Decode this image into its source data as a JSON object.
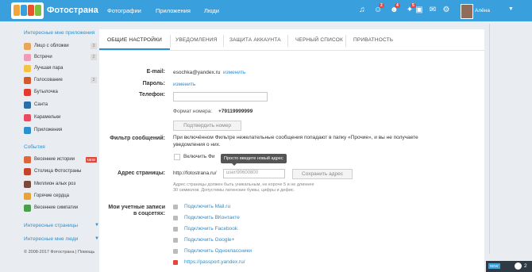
{
  "header": {
    "brand": "Фотострана",
    "nav": [
      "Фотографии",
      "Приложения",
      "Люди"
    ],
    "badges": [
      "2",
      "4",
      "5"
    ],
    "user": "Алёна"
  },
  "sidebar": {
    "section1": "Интересные мне приложения",
    "apps": [
      {
        "label": "Лицо с обложки",
        "count": "3",
        "color": "#e8a65a"
      },
      {
        "label": "Встречи",
        "count": "2",
        "color": "#f09bb8"
      },
      {
        "label": "Лучшая пара",
        "color": "#f6c243"
      },
      {
        "label": "Голосование",
        "count": "2",
        "color": "#d45a2b"
      },
      {
        "label": "Бутылочка",
        "color": "#e23a2e"
      },
      {
        "label": "Санта",
        "color": "#2a6fa8"
      },
      {
        "label": "Карамельки",
        "color": "#e84a5f"
      },
      {
        "label": "Приложения",
        "color": "#2c8fce"
      }
    ],
    "section2": "События",
    "events": [
      {
        "label": "Весенние истории",
        "badge": "NEW",
        "color": "#e0663a"
      },
      {
        "label": "Столица Фотостраны",
        "color": "#c4442a"
      },
      {
        "label": "Миллион алых роз",
        "color": "#7a4b3a"
      },
      {
        "label": "Горячие сердца",
        "color": "#e7a23a"
      },
      {
        "label": "Весенние симпатии",
        "color": "#4aa04a"
      }
    ],
    "section3": "Интересные страницы",
    "section4": "Интересные мне люди",
    "copyright": "© 2008-2017 Фотострана | Помощь"
  },
  "tabs": [
    "ОБЩИЕ НАСТРОЙКИ",
    "УВЕДОМЛЕНИЯ",
    "ЗАЩИТА АККАУНТА",
    "ЧЕРНЫЙ СПИСОК",
    "ПРИВАТНОСТЬ"
  ],
  "form": {
    "email_label": "E-mail:",
    "email_value": "esochka@yandex.ru",
    "email_change": "изменить",
    "password_label": "Пароль:",
    "password_change": "изменить",
    "phone_label": "Телефон:",
    "phone_format_label": "Формат номера:",
    "phone_format": "+79119999999",
    "confirm_button": "Подтвердить номер",
    "filter_label": "Фильтр сообщений:",
    "filter_text_1": "При включённом Фильтре нежелательные сообщения попадают в папку «Прочие», и вы не получаете",
    "filter_text_2": "уведомления о них.",
    "filter_checkbox": "Включить Фи",
    "tooltip": "Просто введите новый адрес",
    "address_label": "Адрес страницы:",
    "address_prefix": "http://fotostrana.ru/",
    "address_placeholder": "user/90600800",
    "save_address": "Сохранить адрес",
    "address_hint_1": "Адрес страницы должен быть уникальным, не короче 5 и не длиннее",
    "address_hint_2": "30 символов. Допустимы латинские буквы, цифры и дефис.",
    "accounts_label_1": "Мои учетные записи",
    "accounts_label_2": "в соцсетях:",
    "accounts": [
      "Подключить Mail.ru",
      "Подключить ВКонтакте",
      "Подключить Facebook",
      "Подключить Google+",
      "Подключить Одноклассники",
      "https://passport.yandex.ru/"
    ]
  },
  "chat": {
    "new": "NEW",
    "count": "2"
  }
}
